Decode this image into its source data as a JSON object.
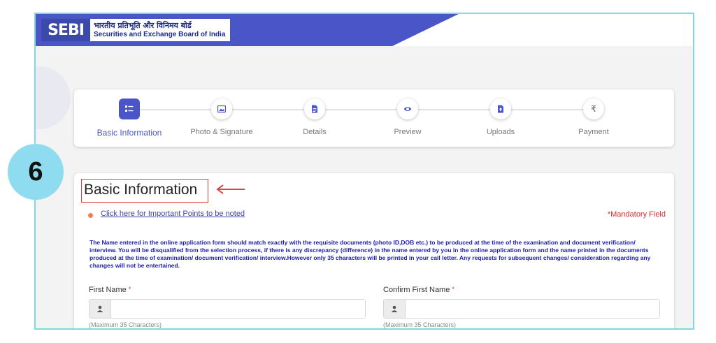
{
  "header": {
    "logo_mark": "SEBI",
    "org_hindi": "भारतीय प्रतिभूति और विनिमय बोर्ड",
    "org_english": "Securities and Exchange Board of India"
  },
  "stepper": {
    "steps": [
      {
        "label": "Basic Information",
        "icon": "list-icon",
        "active": true
      },
      {
        "label": "Photo & Signature",
        "icon": "image-icon",
        "active": false
      },
      {
        "label": "Details",
        "icon": "document-icon",
        "active": false
      },
      {
        "label": "Preview",
        "icon": "eye-icon",
        "active": false
      },
      {
        "label": "Uploads",
        "icon": "upload-icon",
        "active": false
      },
      {
        "label": "Payment",
        "icon": "rupee-icon",
        "active": false
      }
    ]
  },
  "form": {
    "title": "Basic Information",
    "important_link": "Click here for Important Points to be noted",
    "mandatory_note": "*Mandatory Field",
    "notice": "The Name entered in the online application form should match exactly with the requisite documents (photo ID,DOB etc.) to be produced at the time of the examination and document verification/ interview. You will be disqualified from the selection process, if there is any discrepancy (difference) in the name entered by you in the online application form and the name printed in the documents produced at the time of examination/ document verification/ interview.However only 35 characters will be printed in your call letter. Any requests for subsequent changes/ consideration regarding any changes will not be entertained.",
    "first_name": {
      "label": "First Name",
      "required": "*",
      "value": "",
      "hint": "(Maximum 35 Characters)"
    },
    "confirm_first_name": {
      "label": "Confirm First Name",
      "required": "*",
      "value": "",
      "hint": "(Maximum 35 Characters)"
    }
  },
  "annotation": {
    "step_number": "6"
  },
  "colors": {
    "brand": "#4a56c8",
    "annotation_red": "#e04040",
    "badge": "#8fdcf0"
  }
}
